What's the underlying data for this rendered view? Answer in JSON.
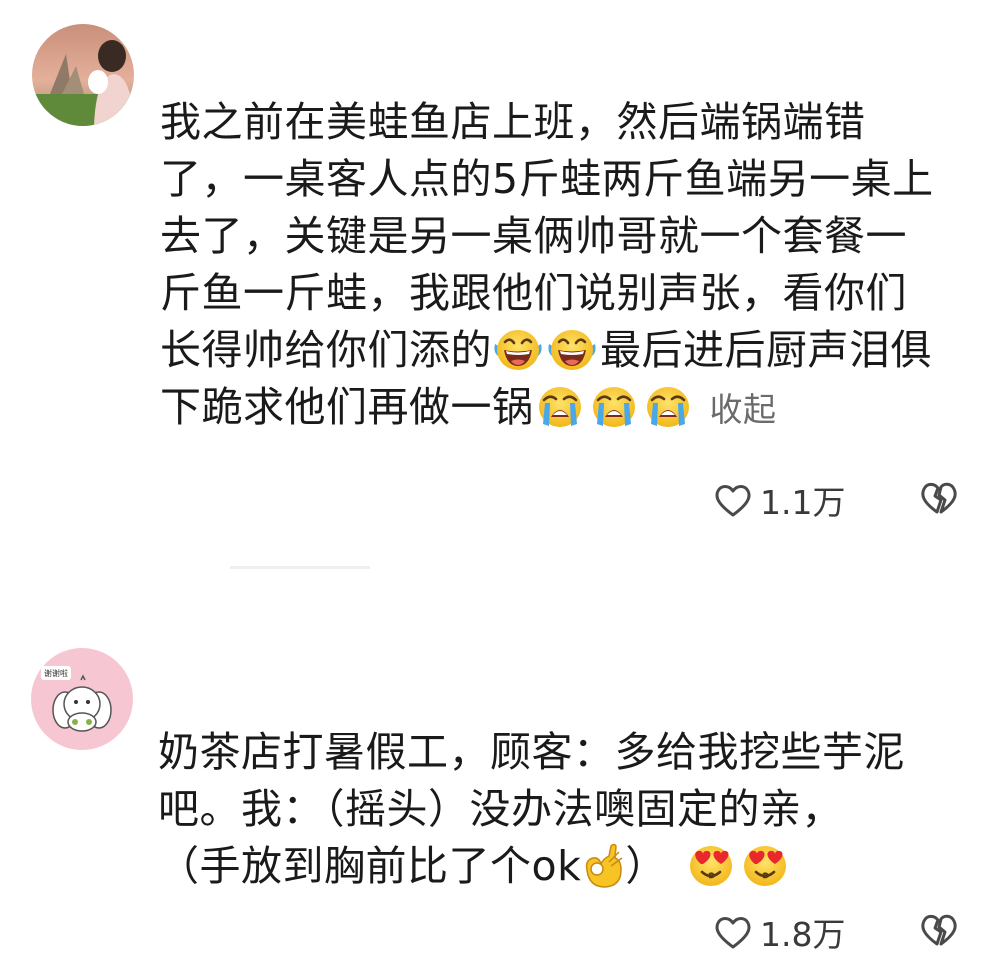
{
  "comments": [
    {
      "lines": [
        "我之前在美蛙鱼店上班，然后端锅端错",
        "了，一桌客人点的5斤蛙两斤鱼端另一桌上",
        "去了，关键是另一桌俩帅哥就一个套餐一",
        "斤鱼一斤蛙，我跟他们说别声张，看你们"
      ],
      "line5_before": "长得帅给你们添的",
      "line5_after": "最后进后厨声泪俱",
      "line6": "下跪求他们再做一锅",
      "collapse_label": "收起",
      "like_count": "1.1万",
      "emojis": {
        "laugh": "laughing-crying-emoji",
        "cry": "loudly-crying-emoji"
      }
    },
    {
      "line1": "奶茶店打暑假工，顾客：多给我挖些芋泥",
      "line2": "吧。我：（摇头）没办法噢固定的亲，",
      "line3_before": "（手放到胸前比了个ok",
      "line3_after": "）",
      "avatar_badge": "谢谢啦",
      "like_count": "1.8万",
      "emojis": {
        "ok": "ok-hand-emoji",
        "love": "heart-eyes-emoji"
      }
    }
  ],
  "colors": {
    "text": "#1a1a1a",
    "muted": "#6b6b6b",
    "emoji_yellow": "#f7c325",
    "tear_blue": "#4aa8e8",
    "heart_red": "#e8282c"
  }
}
